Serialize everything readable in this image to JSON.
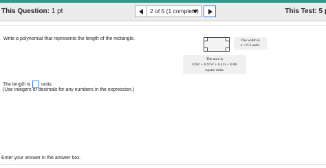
{
  "header": {
    "question_label": "This Question:",
    "question_points": "1 pt",
    "nav_selected": "2 of 5 (1 complete)",
    "test_label": "This Test: 5 p"
  },
  "problem": {
    "prompt": "Write a polynomial that represents the length of the rectangle.",
    "width_line1": "The width is",
    "width_line2": "x + 0.3 units.",
    "area_line1": "The area is",
    "area_line2": "0.9x³ + 0.97x² + 0.41x + 0.06",
    "area_line3": "square units."
  },
  "answer": {
    "prefix": "The length is",
    "suffix": "units.",
    "hint": "(Use integers or decimals for any numbers in the expression.)"
  },
  "footer": {
    "instruction": "Enter your answer in the answer box."
  }
}
